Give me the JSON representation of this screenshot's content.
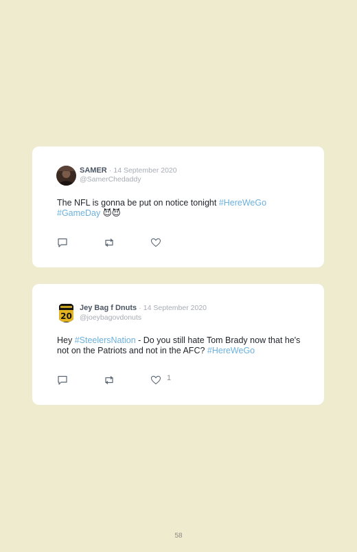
{
  "tweets": [
    {
      "name": "SAMER",
      "separator": "·",
      "date": "14 September 2020",
      "handle": "@SamerChedaddy",
      "text_parts": [
        "The NFL is gonna be put on notice tonight ",
        "#HereWeGo",
        " ",
        "#GameDay",
        " 😈😈"
      ],
      "likes": ""
    },
    {
      "name": "Jey Bag f Dnuts",
      "separator": "·",
      "date": "14 September 2020",
      "handle": "@joeybagovdonuts",
      "avatar_number": "20",
      "text_parts": [
        "Hey ",
        "#SteelersNation",
        " - Do you still hate Tom Brady now that he's not on the Patriots and not in the AFC? ",
        "#HereWeGo"
      ],
      "likes": "1"
    }
  ],
  "page_number": "58",
  "colors": {
    "background": "#eeebcf",
    "card": "#ffffff",
    "hashtag": "#6ab0de",
    "muted": "#a7acb3"
  },
  "icons": [
    "reply-icon",
    "retweet-icon",
    "like-icon"
  ]
}
